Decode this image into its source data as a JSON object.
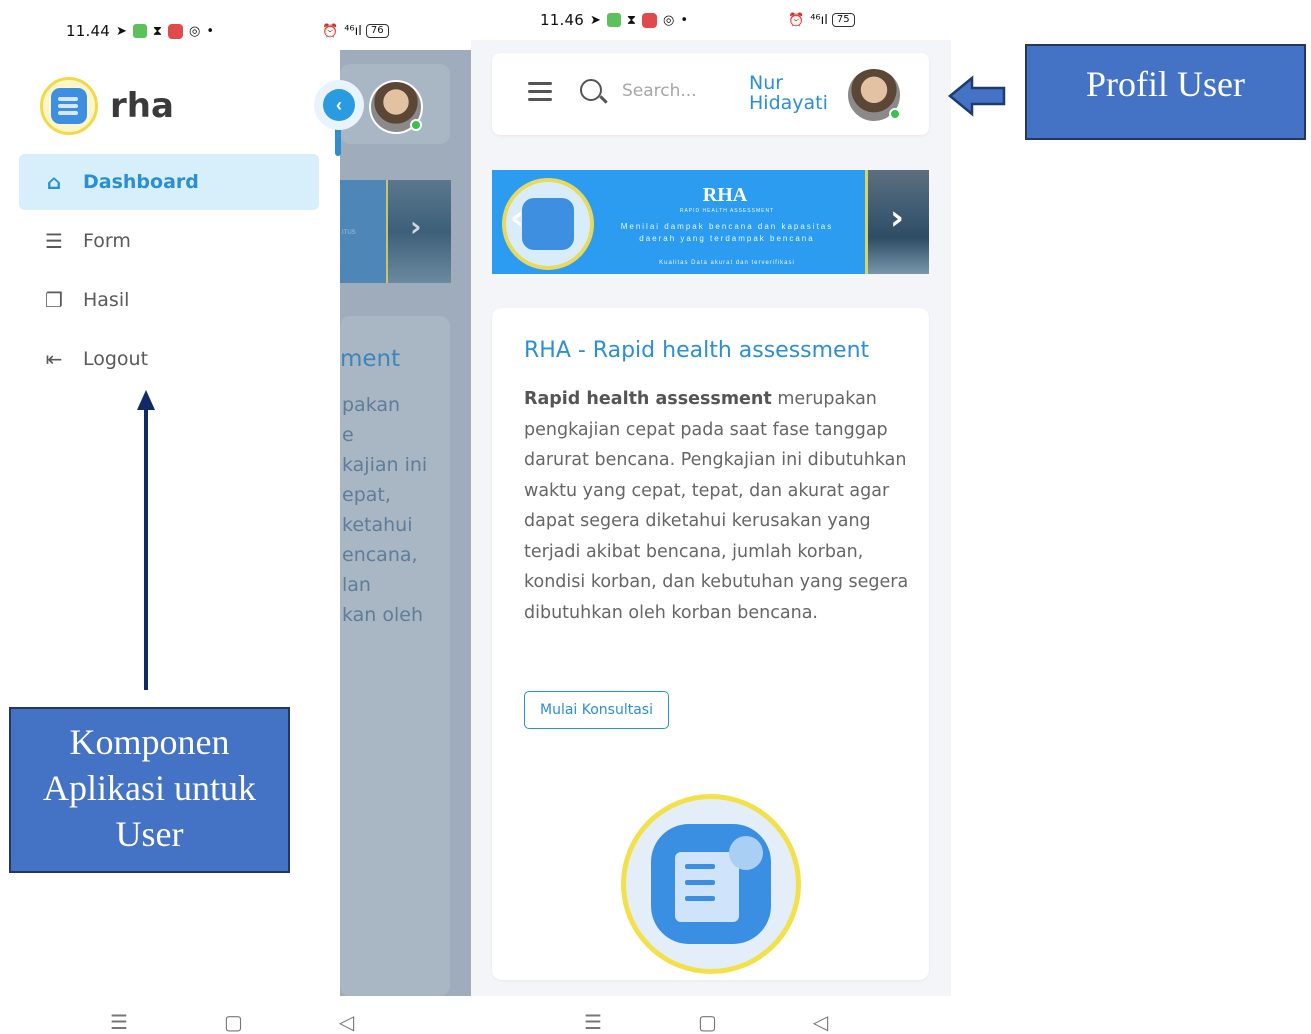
{
  "left_phone": {
    "status": {
      "time": "11.44",
      "battery": "76",
      "signal": "⁴⁶ıl"
    },
    "brand": "rha",
    "menu": [
      {
        "label": "Dashboard",
        "icon": "home-icon",
        "active": true
      },
      {
        "label": "Form",
        "icon": "form-icon",
        "active": false
      },
      {
        "label": "Hasil",
        "icon": "copy-icon",
        "active": false
      },
      {
        "label": "Logout",
        "icon": "logout-icon",
        "active": false
      }
    ],
    "ghost_text": {
      "title": "ment",
      "lines": [
        "pakan",
        "e",
        "kajian ini",
        "epat,",
        "ketahui",
        "encana,",
        "lan",
        "kan oleh"
      ],
      "banner_text": "ITUS"
    }
  },
  "right_phone": {
    "status": {
      "time": "11.46",
      "battery": "75",
      "signal": "⁴⁶ıl"
    },
    "search": {
      "placeholder": "Search..."
    },
    "user": {
      "first_name": "Nur",
      "last_name": "Hidayati"
    },
    "banner": {
      "title": "RHA",
      "subtitle": "RAPID HEALTH ASSESSMENT",
      "line1": "Menilai dampak bencana dan kapasitas",
      "line2": "daerah yang terdampak bencana",
      "footer": "Kualitas Data akurat dan terverifikasi"
    },
    "card": {
      "title": "RHA - Rapid health assessment",
      "body_bold": "Rapid health assessment",
      "body_rest": " merupakan pengkajian cepat pada saat fase tanggap darurat bencana. Pengkajian ini dibutuhkan waktu yang cepat, tepat, dan akurat agar dapat segera diketahui kerusakan yang terjadi akibat bencana, jumlah korban, kondisi korban, dan kebutuhan yang segera dibutuhkan oleh korban bencana.",
      "cta": "Mulai Konsultasi"
    }
  },
  "annotations": {
    "profile_label": "Profil User",
    "components_label": "Komponen Aplikasi untuk User"
  },
  "colors": {
    "accent": "#2a8fd4",
    "callout_fill": "#4472c4",
    "arrow": "#1f3a70"
  }
}
